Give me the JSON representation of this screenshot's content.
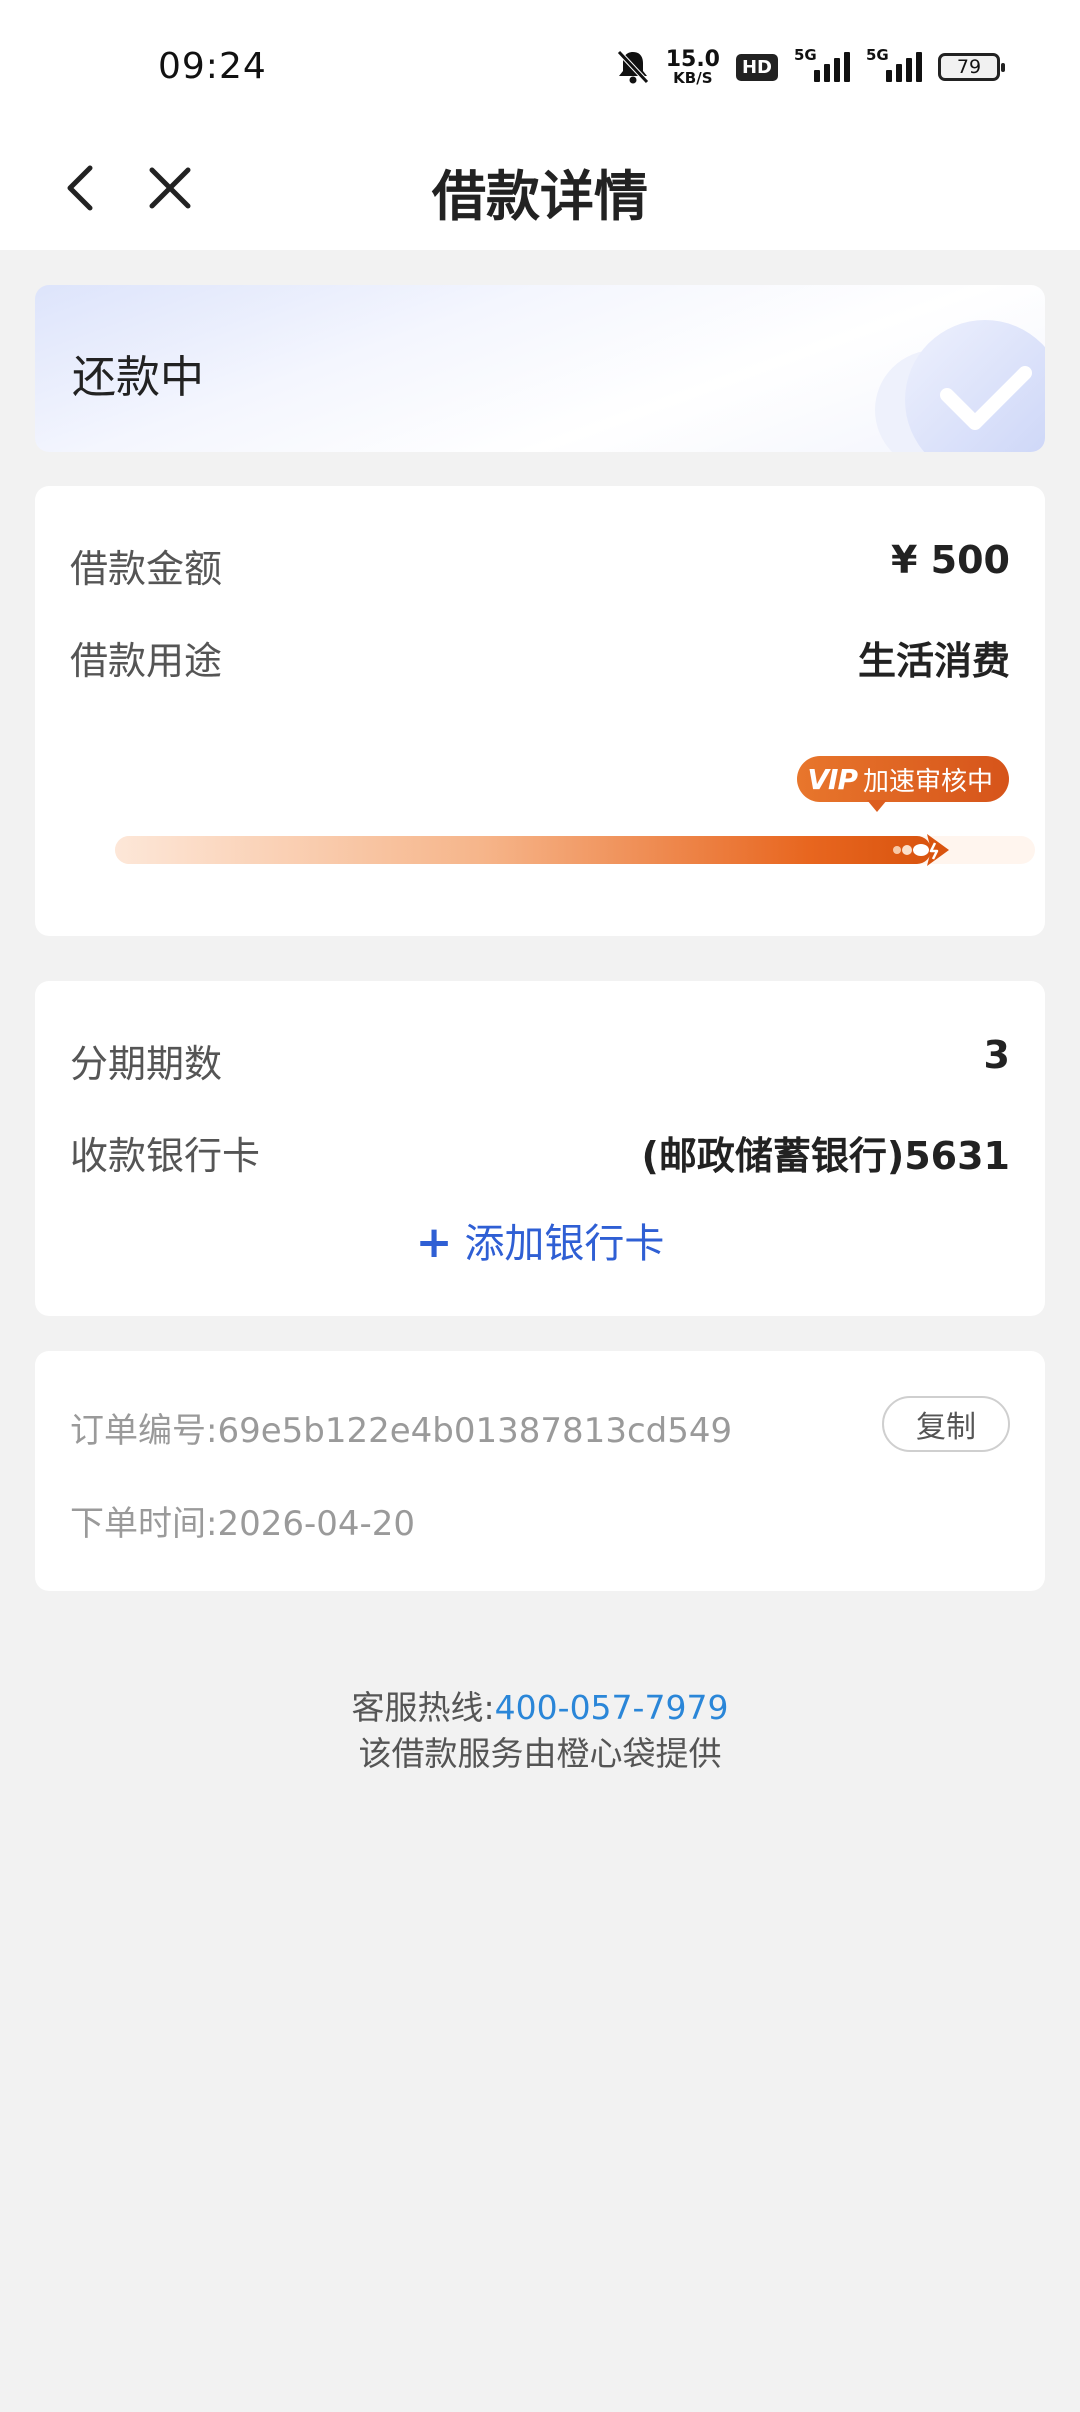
{
  "status_bar": {
    "time": "09:24",
    "net_speed_value": "15.0",
    "net_speed_unit": "KB/S",
    "hd_label": "HD",
    "signal1_tag": "5G",
    "signal2_tag": "5G",
    "battery": "79",
    "icons": [
      "bell-muted-icon",
      "signal-icon",
      "battery-icon"
    ]
  },
  "nav": {
    "title": "借款详情",
    "back_icon": "chevron-left-icon",
    "close_icon": "close-icon"
  },
  "status_card": {
    "status": "还款中",
    "emblem_icon": "check-circle-icon"
  },
  "loan": {
    "amount_label": "借款金额",
    "amount_value": "¥ 500",
    "purpose_label": "借款用途",
    "purpose_value": "生活消费",
    "vip_badge_mark": "VIP",
    "vip_badge_text": "加速审核中",
    "progress_fraction": 0.93
  },
  "installment": {
    "periods_label": "分期期数",
    "periods_value": "3",
    "bank_label": "收款银行卡",
    "bank_value": "(邮政储蓄银行)5631",
    "add_card_plus": "+",
    "add_card_label": "添加银行卡"
  },
  "order": {
    "order_no_label": "订单编号:",
    "order_no_value": "69e5b122e4b01387813cd549",
    "copy_label": "复制",
    "order_time_label": "下单时间:",
    "order_time_value": "2026-04-20"
  },
  "footer": {
    "hotline_label": "客服热线:",
    "hotline_number": "400-057-7979",
    "provider_text": "该借款服务由橙心袋提供"
  },
  "colors": {
    "accent_blue": "#2f5fd4",
    "link_blue": "#2a86d8",
    "progress_orange": "#e8661f",
    "background": "#f2f2f2"
  }
}
